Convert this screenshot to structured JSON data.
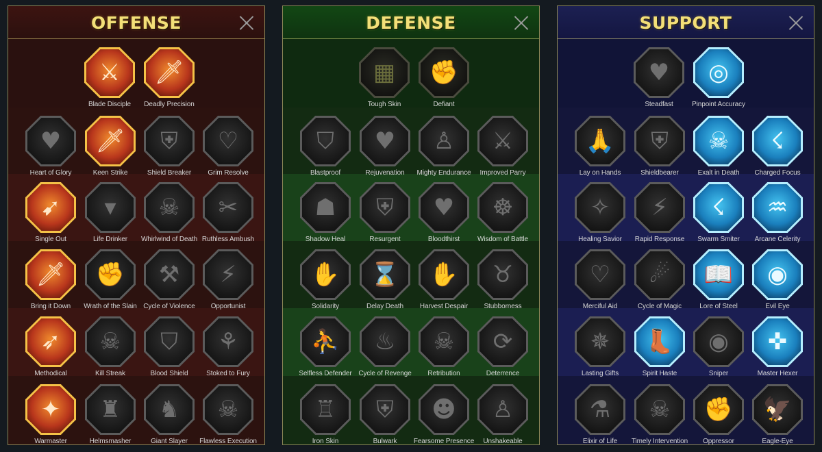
{
  "panels": [
    {
      "key": "offense",
      "title": "OFFENSE",
      "talents": [
        {
          "name": "Blade Disciple",
          "icon": "crossed-swords-icon",
          "glyph": "⚔",
          "state": "active"
        },
        {
          "name": "Deadly Precision",
          "icon": "dagger-strike-icon",
          "glyph": "🗡",
          "state": "active"
        },
        {
          "name": "Heart of Glory",
          "icon": "horned-heart-icon",
          "glyph": "♥",
          "state": "locked"
        },
        {
          "name": "Keen Strike",
          "icon": "sword-slash-icon",
          "glyph": "🗡",
          "state": "active"
        },
        {
          "name": "Shield Breaker",
          "icon": "broken-shield-icon",
          "glyph": "⛨",
          "state": "locked"
        },
        {
          "name": "Grim Resolve",
          "icon": "grim-heart-icon",
          "glyph": "♡",
          "state": "locked"
        },
        {
          "name": "Single Out",
          "icon": "arrows-target-icon",
          "glyph": "➹",
          "state": "active"
        },
        {
          "name": "Life Drinker",
          "icon": "fanged-mouth-icon",
          "glyph": "▾",
          "state": "locked"
        },
        {
          "name": "Whirlwind of Death",
          "icon": "skull-whirlwind-icon",
          "glyph": "☠",
          "state": "locked"
        },
        {
          "name": "Ruthless Ambush",
          "icon": "ambush-claw-icon",
          "glyph": "✂",
          "state": "locked"
        },
        {
          "name": "Bring it Down",
          "icon": "falling-sword-icon",
          "glyph": "🗡",
          "state": "active"
        },
        {
          "name": "Wrath of the Slain",
          "icon": "fist-hammer-icon",
          "glyph": "✊",
          "state": "locked"
        },
        {
          "name": "Cycle of Violence",
          "icon": "axe-cycle-icon",
          "glyph": "⚒",
          "state": "locked"
        },
        {
          "name": "Opportunist",
          "icon": "lightning-chain-icon",
          "glyph": "⚡",
          "state": "locked"
        },
        {
          "name": "Methodical",
          "icon": "arrow-volley-icon",
          "glyph": "➶",
          "state": "active"
        },
        {
          "name": "Kill Streak",
          "icon": "skulls-icon",
          "glyph": "☠",
          "state": "locked"
        },
        {
          "name": "Blood Shield",
          "icon": "blood-shield-icon",
          "glyph": "⛉",
          "state": "locked"
        },
        {
          "name": "Stoked to Fury",
          "icon": "raging-warrior-icon",
          "glyph": "⚘",
          "state": "locked"
        },
        {
          "name": "Warmaster",
          "icon": "war-hammer-icon",
          "glyph": "✦",
          "state": "active"
        },
        {
          "name": "Helmsmasher",
          "icon": "knight-helm-icon",
          "glyph": "♜",
          "state": "locked"
        },
        {
          "name": "Giant Slayer",
          "icon": "giant-icon",
          "glyph": "♞",
          "state": "locked"
        },
        {
          "name": "Flawless Execution",
          "icon": "skull-spears-icon",
          "glyph": "☠",
          "state": "locked"
        }
      ]
    },
    {
      "key": "defense",
      "title": "DEFENSE",
      "talents": [
        {
          "name": "Tough Skin",
          "icon": "scales-icon",
          "glyph": "▦",
          "state": "dim"
        },
        {
          "name": "Defiant",
          "icon": "raised-fist-icon",
          "glyph": "✊",
          "state": "dim"
        },
        {
          "name": "Blastproof",
          "icon": "chevron-shield-icon",
          "glyph": "⛉",
          "state": "locked"
        },
        {
          "name": "Rejuvenation",
          "icon": "heart-vessel-icon",
          "glyph": "♥",
          "state": "locked"
        },
        {
          "name": "Mighty Endurance",
          "icon": "muscular-torso-icon",
          "glyph": "♙",
          "state": "locked"
        },
        {
          "name": "Improved Parry",
          "icon": "crossed-blades-icon",
          "glyph": "⚔",
          "state": "locked"
        },
        {
          "name": "Shadow Heal",
          "icon": "shadow-figure-icon",
          "glyph": "☗",
          "state": "locked"
        },
        {
          "name": "Resurgent",
          "icon": "shield-warrior-icon",
          "glyph": "⛨",
          "state": "locked"
        },
        {
          "name": "Bloodthirst",
          "icon": "blood-heart-icon",
          "glyph": "♥",
          "state": "locked"
        },
        {
          "name": "Wisdom of Battle",
          "icon": "meditating-figure-icon",
          "glyph": "☸",
          "state": "locked"
        },
        {
          "name": "Solidarity",
          "icon": "raised-hands-icon",
          "glyph": "✋",
          "state": "locked"
        },
        {
          "name": "Delay Death",
          "icon": "hourglass-skull-icon",
          "glyph": "⌛",
          "state": "locked"
        },
        {
          "name": "Harvest Despair",
          "icon": "open-hand-icon",
          "glyph": "✋",
          "state": "locked"
        },
        {
          "name": "Stubborness",
          "icon": "bull-skull-icon",
          "glyph": "♉",
          "state": "locked"
        },
        {
          "name": "Selfless Defender",
          "icon": "running-defender-icon",
          "glyph": "⛹",
          "state": "locked"
        },
        {
          "name": "Cycle of Revenge",
          "icon": "flames-icon",
          "glyph": "♨",
          "state": "locked"
        },
        {
          "name": "Retribution",
          "icon": "spiked-skull-icon",
          "glyph": "☠",
          "state": "locked"
        },
        {
          "name": "Deterrence",
          "icon": "sword-circle-icon",
          "glyph": "⟳",
          "state": "locked"
        },
        {
          "name": "Iron Skin",
          "icon": "armored-figure-icon",
          "glyph": "♖",
          "state": "locked"
        },
        {
          "name": "Bulwark",
          "icon": "wall-shield-icon",
          "glyph": "⛨",
          "state": "locked"
        },
        {
          "name": "Fearsome Presence",
          "icon": "bearded-face-icon",
          "glyph": "☻",
          "state": "locked"
        },
        {
          "name": "Unshakeable",
          "icon": "flexing-figure-icon",
          "glyph": "♙",
          "state": "locked"
        }
      ]
    },
    {
      "key": "support",
      "title": "SUPPORT",
      "talents": [
        {
          "name": "Steadfast",
          "icon": "heart-sparkles-icon",
          "glyph": "♥",
          "state": "locked"
        },
        {
          "name": "Pinpoint Accuracy",
          "icon": "target-arrow-icon",
          "glyph": "◎",
          "state": "active"
        },
        {
          "name": "Lay on Hands",
          "icon": "praying-hands-icon",
          "glyph": "🙏",
          "state": "locked"
        },
        {
          "name": "Shieldbearer",
          "icon": "radiant-shield-icon",
          "glyph": "⛨",
          "state": "locked"
        },
        {
          "name": "Exalt in Death",
          "icon": "flaming-skull-icon",
          "glyph": "☠",
          "state": "active"
        },
        {
          "name": "Charged Focus",
          "icon": "charged-hand-icon",
          "glyph": "☇",
          "state": "active"
        },
        {
          "name": "Healing Savior",
          "icon": "sparkling-figure-icon",
          "glyph": "✧",
          "state": "locked"
        },
        {
          "name": "Rapid Response",
          "icon": "lightning-bolt-icon",
          "glyph": "⚡",
          "state": "locked"
        },
        {
          "name": "Swarm Smiter",
          "icon": "shattered-bolt-icon",
          "glyph": "☇",
          "state": "active"
        },
        {
          "name": "Arcane Celerity",
          "icon": "speeding-figures-icon",
          "glyph": "♒",
          "state": "active"
        },
        {
          "name": "Merciful Aid",
          "icon": "chained-heart-icon",
          "glyph": "♡",
          "state": "locked"
        },
        {
          "name": "Cycle of Magic",
          "icon": "magic-swirl-icon",
          "glyph": "☄",
          "state": "locked"
        },
        {
          "name": "Lore of Steel",
          "icon": "open-book-icon",
          "glyph": "📖",
          "state": "active"
        },
        {
          "name": "Evil Eye",
          "icon": "angry-eyes-icon",
          "glyph": "◉",
          "state": "active"
        },
        {
          "name": "Lasting Gifts",
          "icon": "compass-star-icon",
          "glyph": "✵",
          "state": "locked"
        },
        {
          "name": "Spirit Haste",
          "icon": "winged-boot-icon",
          "glyph": "👢",
          "state": "active"
        },
        {
          "name": "Sniper",
          "icon": "eye-icon",
          "glyph": "◉",
          "state": "locked"
        },
        {
          "name": "Master Hexer",
          "icon": "voodoo-doll-icon",
          "glyph": "✜",
          "state": "active"
        },
        {
          "name": "Elixir of Life",
          "icon": "potion-flask-icon",
          "glyph": "⚗",
          "state": "locked"
        },
        {
          "name": "Timely Intervention",
          "icon": "winged-skull-icon",
          "glyph": "☠",
          "state": "locked"
        },
        {
          "name": "Oppressor",
          "icon": "crushing-fist-icon",
          "glyph": "✊",
          "state": "locked"
        },
        {
          "name": "Eagle-Eye",
          "icon": "eagle-head-icon",
          "glyph": "🦅",
          "state": "locked"
        }
      ]
    }
  ]
}
